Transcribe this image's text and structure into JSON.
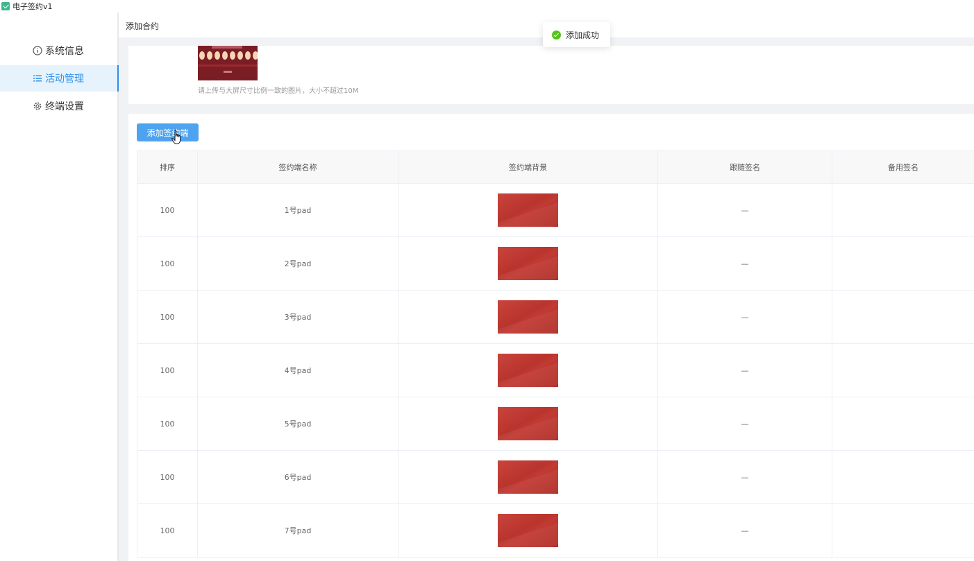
{
  "window": {
    "title": "电子签约v1"
  },
  "sidebar": {
    "items": [
      {
        "label": "系统信息",
        "icon": "info-icon"
      },
      {
        "label": "活动管理",
        "icon": "list-icon"
      },
      {
        "label": "终端设置",
        "icon": "gear-icon"
      }
    ],
    "active_index": 1
  },
  "breadcrumb": {
    "current": "添加合约"
  },
  "upload": {
    "hint": "请上传与大屏尺寸比例一致的图片，大小不超过10M"
  },
  "toolbar": {
    "add_button_label": "添加签约端"
  },
  "table": {
    "headers": [
      "排序",
      "签约端名称",
      "签约端背景",
      "跟随签名",
      "备用签名"
    ],
    "rows": [
      {
        "order": "100",
        "name": "1号pad",
        "follow": "—",
        "backup": ""
      },
      {
        "order": "100",
        "name": "2号pad",
        "follow": "—",
        "backup": ""
      },
      {
        "order": "100",
        "name": "3号pad",
        "follow": "—",
        "backup": ""
      },
      {
        "order": "100",
        "name": "4号pad",
        "follow": "—",
        "backup": ""
      },
      {
        "order": "100",
        "name": "5号pad",
        "follow": "—",
        "backup": ""
      },
      {
        "order": "100",
        "name": "6号pad",
        "follow": "—",
        "backup": ""
      },
      {
        "order": "100",
        "name": "7号pad",
        "follow": "—",
        "backup": ""
      }
    ]
  },
  "toast": {
    "message": "添加成功",
    "icon": "check-circle-icon"
  },
  "colors": {
    "accent": "#2c8fe8",
    "button": "#4ea3f1",
    "success": "#52c41a",
    "thumb_red": "#b8342d"
  }
}
